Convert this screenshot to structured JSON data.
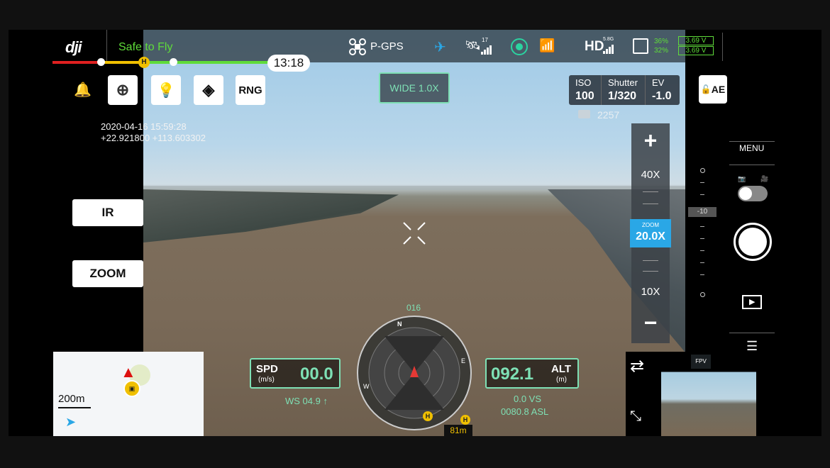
{
  "topbar": {
    "logo": "dji",
    "flight_status": "Safe to Fly",
    "gps_mode": "P-GPS",
    "satellites": "17",
    "hd_label": "HD",
    "hd_band": "5.8G",
    "battery_pct_1": "36%",
    "battery_pct_2": "32%",
    "voltage_1": "3.69 V",
    "voltage_2": "3.69 V",
    "flight_time": "13:18",
    "more_icon": "more-icon"
  },
  "toolbar": {
    "rng_label": "RNG",
    "camera_mode": "WIDE  1.0X"
  },
  "camera_params": {
    "iso_label": "ISO",
    "iso_value": "100",
    "shutter_label": "Shutter",
    "shutter_value": "1/320",
    "ev_label": "EV",
    "ev_value": "-1.0",
    "ae_label": "AE",
    "storage_count": "2257"
  },
  "overlay": {
    "datetime": "2020-04-16 15:59:28",
    "coordinates": "+22.921800 +113.603302"
  },
  "side_buttons": {
    "ir": "IR",
    "zoom": "ZOOM"
  },
  "zoom_panel": {
    "plus": "+",
    "level_40": "40X",
    "zoom_caption": "ZOOM",
    "zoom_value": "20.0X",
    "level_10": "10X",
    "minus": "−"
  },
  "right_panel": {
    "menu": "MENU",
    "scale_value": "-10"
  },
  "telemetry": {
    "spd_label": "SPD",
    "spd_unit": "(m/s)",
    "spd_value": "00.0",
    "ws": "WS 04.9 ↑",
    "alt_label": "ALT",
    "alt_unit": "(m)",
    "alt_value": "092.1",
    "vs": "0.0  VS",
    "asl": "0080.8 ASL",
    "heading": "016",
    "home_distance": "81m"
  },
  "minimap": {
    "scale": "200m"
  },
  "pip": {
    "label": "FPV"
  },
  "colors": {
    "accent_green": "#7ee0b5",
    "status_green": "#5fdc3a",
    "zoom_blue": "#2aa7e6"
  }
}
